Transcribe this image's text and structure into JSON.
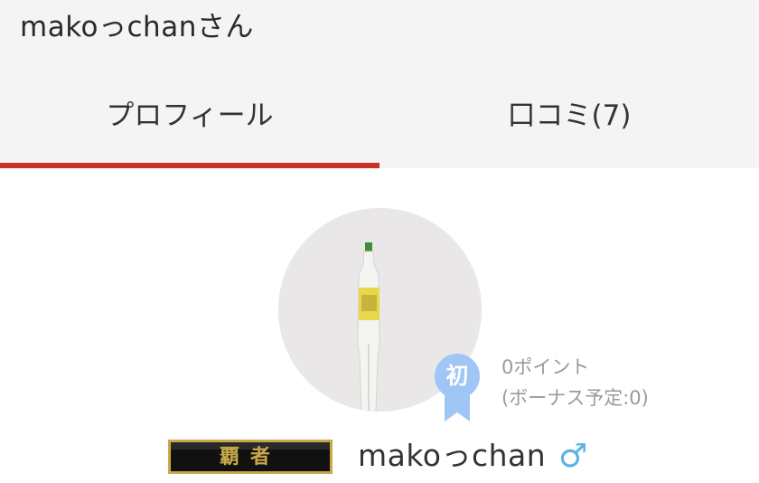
{
  "header": {
    "title": "makoっchanさん"
  },
  "tabs": [
    {
      "label": "プロフィール",
      "active": true
    },
    {
      "label": "口コミ(7)",
      "active": false
    }
  ],
  "profile": {
    "badge": "初",
    "points": "0ポイント",
    "bonus": "(ボーナス予定:0)",
    "title_plate": "覇者",
    "username": "makoっchan",
    "gender_symbol": "♂"
  },
  "colors": {
    "accent": "#cc3126",
    "badge": "#9fc6f5",
    "gender": "#5bb3e2",
    "header_bg": "#f4f4f4"
  },
  "icons": {
    "badge": "ribbon-badge-icon",
    "gender": "male-icon",
    "avatar": "user-avatar"
  }
}
